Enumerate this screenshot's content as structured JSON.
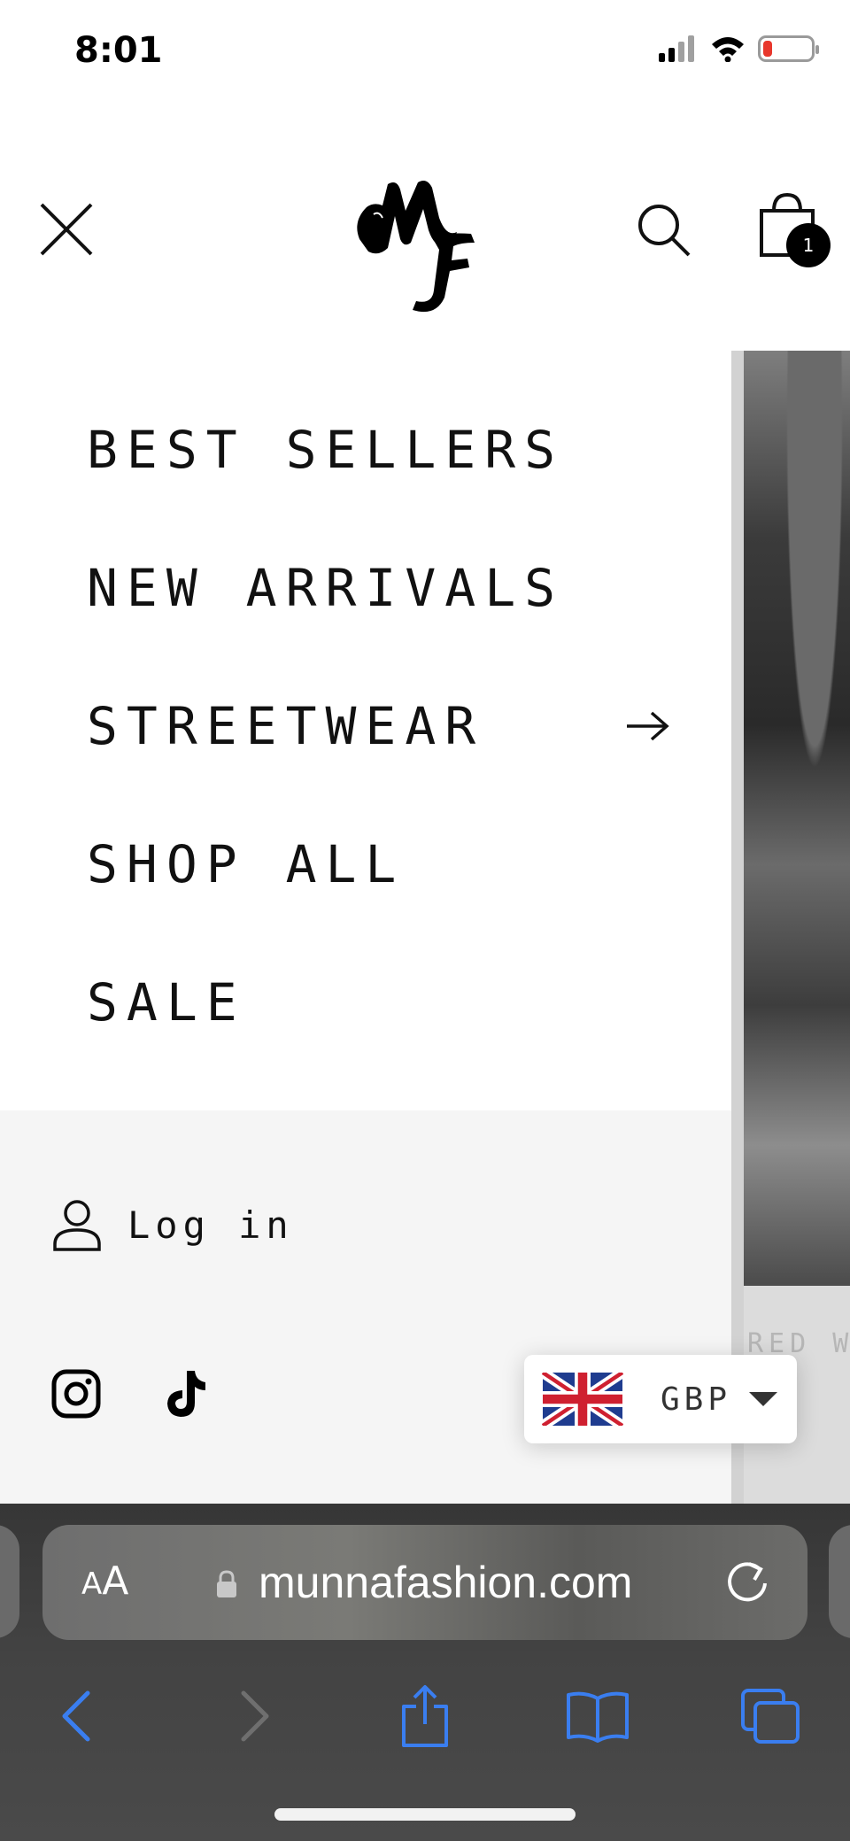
{
  "status_bar": {
    "time": "8:01",
    "signal_icon": "cellular-signal-icon",
    "wifi_icon": "wifi-icon",
    "battery_icon": "battery-low-icon",
    "battery_level": 0.12
  },
  "header": {
    "close_icon": "close-icon",
    "logo_icon": "mf-monogram-logo",
    "search_icon": "search-icon",
    "cart_icon": "shopping-bag-icon",
    "cart_count": "1"
  },
  "menu": {
    "items": [
      {
        "label": "BEST SELLERS",
        "has_submenu": false
      },
      {
        "label": "NEW ARRIVALS",
        "has_submenu": false
      },
      {
        "label": "STREETWEAR",
        "has_submenu": true,
        "submenu_icon": "arrow-right-icon"
      },
      {
        "label": "SHOP ALL",
        "has_submenu": false
      },
      {
        "label": "SALE",
        "has_submenu": false
      }
    ]
  },
  "account": {
    "login_label": "Log in",
    "login_icon": "user-icon"
  },
  "social": {
    "icons": [
      "instagram-icon",
      "tiktok-icon"
    ]
  },
  "currency": {
    "code": "GBP",
    "flag_icon": "uk-flag-icon"
  },
  "background_page": {
    "partial_text": "RED W"
  },
  "browser": {
    "text_size_label_small": "A",
    "text_size_label_big": "A",
    "url": "munnafashion.com",
    "lock_icon": "lock-icon",
    "reload_icon": "reload-icon",
    "toolbar_icons": [
      "back-icon",
      "forward-icon",
      "share-icon",
      "bookmarks-icon",
      "tabs-icon"
    ]
  },
  "colors": {
    "accent_browser": "#3a7ef0",
    "text_primary": "#111111",
    "drawer_footer_bg": "#f5f5f5",
    "battery_low": "#e8372c"
  }
}
